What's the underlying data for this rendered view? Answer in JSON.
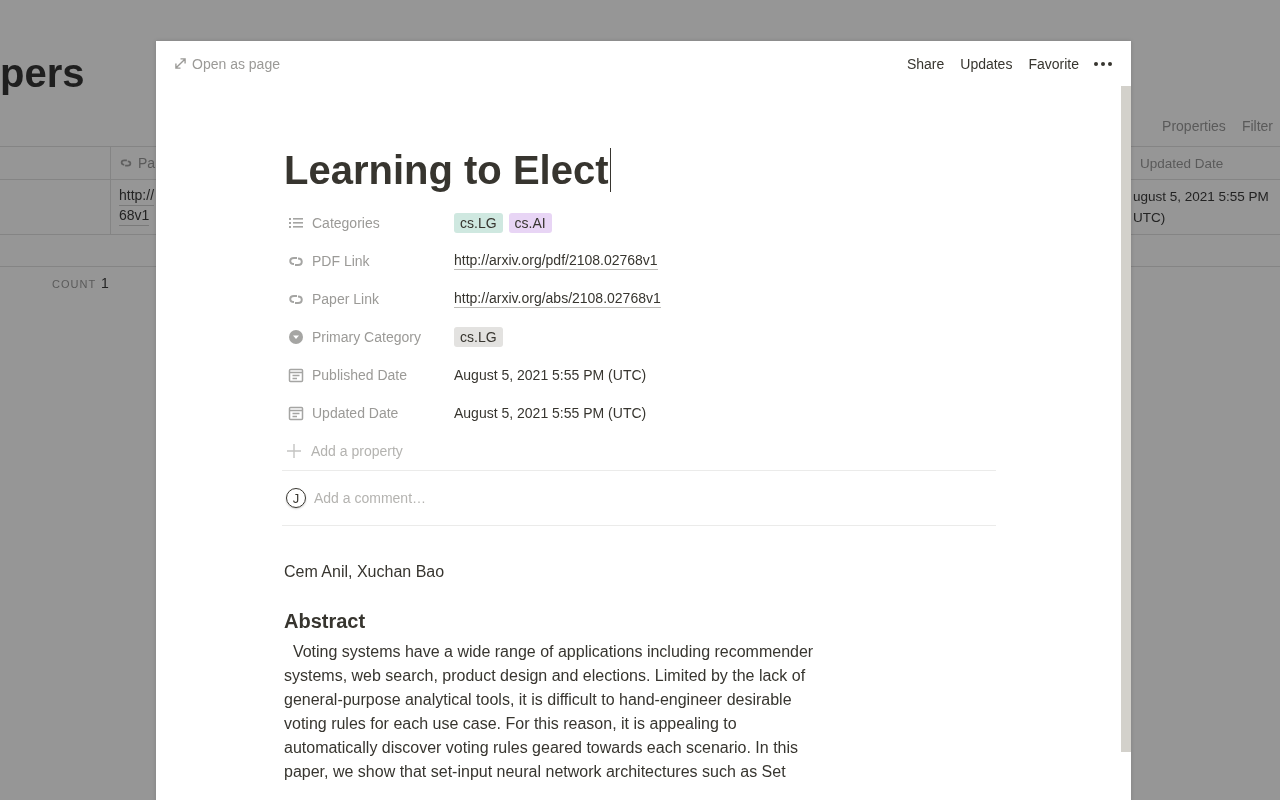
{
  "background_page": {
    "title": "pers",
    "view_actions": [
      "Properties",
      "Filter"
    ],
    "table": {
      "columns": [
        {},
        {
          "label": "Pa"
        },
        {
          "label": "Updated Date"
        }
      ],
      "rows": [
        {
          "cells": [
            [],
            [
              "http://",
              "68v1"
            ],
            [
              "ugust 5, 2021 5:55 PM",
              "UTC)"
            ]
          ]
        }
      ]
    },
    "count": {
      "label": "COUNT",
      "value": "1"
    }
  },
  "modal": {
    "open_as_page": "Open as page",
    "actions": [
      "Share",
      "Updates",
      "Favorite"
    ],
    "title": "Learning to Elect",
    "properties": [
      {
        "name": "Categories",
        "kind": "multi_select",
        "tags": [
          {
            "text": "cs.LG",
            "color": "#cfe8e0"
          },
          {
            "text": "cs.AI",
            "color": "#e8d5f5"
          }
        ]
      },
      {
        "name": "PDF Link",
        "kind": "url",
        "value": "http://arxiv.org/pdf/2108.02768v1"
      },
      {
        "name": "Paper Link",
        "kind": "url",
        "value": "http://arxiv.org/abs/2108.02768v1"
      },
      {
        "name": "Primary Category",
        "kind": "select",
        "tags": [
          {
            "text": "cs.LG",
            "color": "#e3e2e0"
          }
        ]
      },
      {
        "name": "Published Date",
        "kind": "date",
        "value": "August 5, 2021 5:55 PM (UTC)"
      },
      {
        "name": "Updated Date",
        "kind": "date",
        "value": "August 5, 2021 5:55 PM (UTC)"
      }
    ],
    "add_property": "Add a property",
    "comment": {
      "avatar": "J",
      "placeholder": "Add a comment…"
    },
    "authors": "Cem Anil, Xuchan Bao",
    "heading": "Abstract",
    "abstract": "  Voting systems have a wide range of applications including recommender systems, web search, product design and elections. Limited by the lack of general-purpose analytical tools, it is difficult to hand-engineer desirable voting rules for each use case. For this reason, it is appealing to automatically discover voting rules geared towards each scenario. In this paper, we show that set-input neural network architectures such as Set"
  }
}
